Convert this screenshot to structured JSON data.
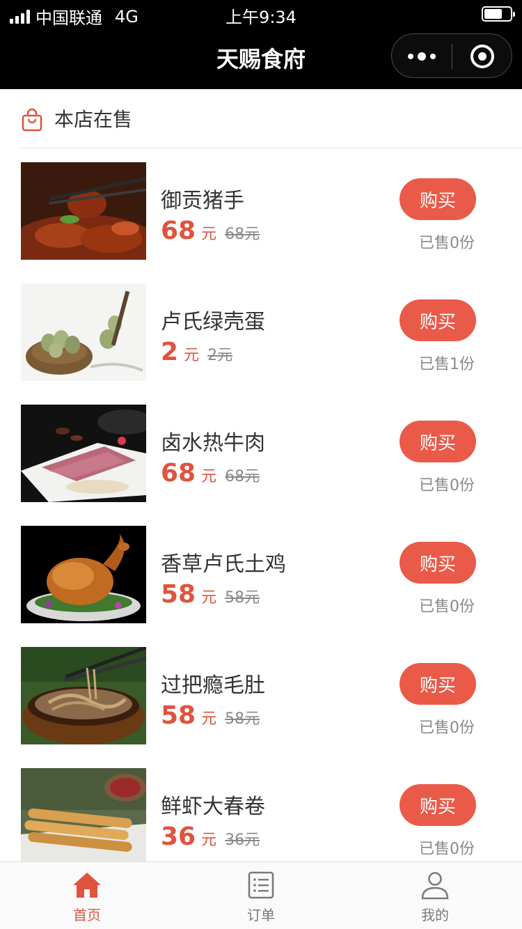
{
  "status_bar": {
    "carrier": "中国联通",
    "network": "4G",
    "time": "上午9:34",
    "battery_level": 0.7
  },
  "nav": {
    "title": "天赐食府"
  },
  "section": {
    "title": "本店在售"
  },
  "buy_label": "购买",
  "price_unit": "元",
  "products": [
    {
      "name": "御贡猪手",
      "price": "68",
      "original": "68元",
      "sold": "已售0份",
      "image_icon": "pork-knuckle-photo"
    },
    {
      "name": "卢氏绿壳蛋",
      "price": "2",
      "original": "2元",
      "sold": "已售1份",
      "image_icon": "eggs-in-nest-photo"
    },
    {
      "name": "卤水热牛肉",
      "price": "68",
      "original": "68元",
      "sold": "已售0份",
      "image_icon": "sliced-beef-photo"
    },
    {
      "name": "香草卢氏土鸡",
      "price": "58",
      "original": "58元",
      "sold": "已售0份",
      "image_icon": "roast-chicken-photo"
    },
    {
      "name": "过把瘾毛肚",
      "price": "58",
      "original": "58元",
      "sold": "已售0份",
      "image_icon": "tripe-bowl-photo"
    },
    {
      "name": "鲜虾大春卷",
      "price": "36",
      "original": "36元",
      "sold": "已售0份",
      "image_icon": "spring-rolls-photo"
    }
  ],
  "tabs": [
    {
      "label": "首页",
      "icon": "home-icon",
      "active": true
    },
    {
      "label": "订单",
      "icon": "orders-icon",
      "active": false
    },
    {
      "label": "我的",
      "icon": "profile-icon",
      "active": false
    }
  ],
  "colors": {
    "accent": "#e0533e",
    "button": "#ea5a49",
    "nav_background": "#000000"
  }
}
